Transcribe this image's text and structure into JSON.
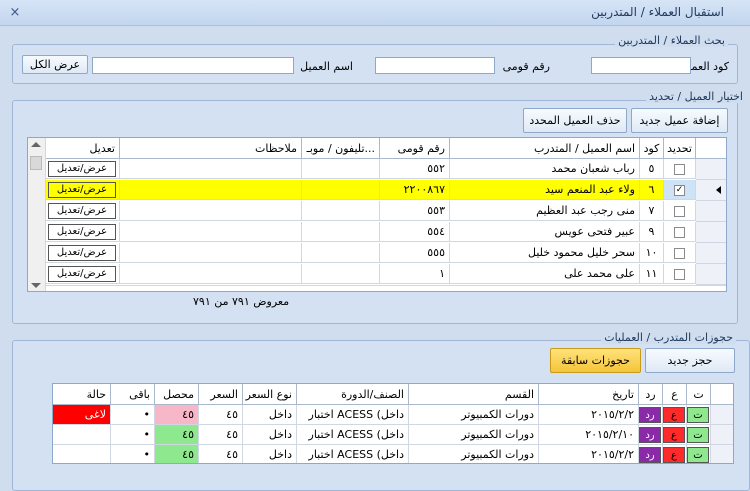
{
  "window": {
    "title": "استقبال العملاء / المتدربين",
    "close_icon": "×"
  },
  "search": {
    "group_label": "بحث العملاء / المتدربين",
    "code_label": "كود العميل",
    "name_label": "اسم العميل",
    "national_id_label": "رقم قومى",
    "show_all_label": "عرض الكل"
  },
  "select": {
    "group_label": "اختيار العميل / تحديد",
    "add_new_label": "إضافة عميل جديد",
    "delete_label": "حذف العميل المحدد",
    "columns": {
      "select": "تحديد",
      "code": "كود",
      "name": "اسم العميل / المتدرب",
      "national_id": "رقم قومى",
      "phone": "تليفون / موبـ...",
      "notes": "ملاحظات",
      "edit": "تعديل"
    },
    "rows": [
      {
        "checked": false,
        "code": "٥",
        "name": "رباب شعبان محمد",
        "national_id": "٥٥٢",
        "edit": "عرض/تعديل"
      },
      {
        "checked": true,
        "code": "٦",
        "name": "ولاء عبد المنعم سيد",
        "national_id": "٢٢٠٠٨٦٧",
        "edit": "عرض/تعديل"
      },
      {
        "checked": false,
        "code": "٧",
        "name": "منى رجب عبد العظيم",
        "national_id": "٥٥٣",
        "edit": "عرض/تعديل"
      },
      {
        "checked": false,
        "code": "٩",
        "name": "عبير فتحى عويس",
        "national_id": "٥٥٤",
        "edit": "عرض/تعديل"
      },
      {
        "checked": false,
        "code": "١٠",
        "name": "سحر خليل محمود خليل",
        "national_id": "٥٥٥",
        "edit": "عرض/تعديل"
      },
      {
        "checked": false,
        "code": "١١",
        "name": "على محمد على",
        "national_id": "١",
        "edit": "عرض/تعديل"
      }
    ],
    "count_text": "معروض ٧٩١ من ٧٩١"
  },
  "bookings": {
    "group_label": "حجوزات المتدرب / العمليات",
    "new_booking_label": "حجز جديد",
    "prev_bookings_label": "حجوزات سابقة",
    "columns": {
      "t": "ت",
      "a": "ع",
      "r": "رد",
      "date": "تاريخ",
      "dept": "القسم",
      "course": "الصنف/الدورة",
      "price_type": "نوع السعر",
      "price": "السعر",
      "paid": "محصل",
      "remaining": "باقى",
      "status": "حالة"
    },
    "rows": [
      {
        "t": "ت",
        "a": "ع",
        "r": "رد",
        "date": "٢٠١٥/٢/٢",
        "dept": "دورات الكمبيوتر",
        "course": "اختبار ACESS (داخل",
        "price_type": "داخل",
        "price": "٤٥",
        "paid": "٤٥",
        "remaining": "•",
        "status": "لاغى"
      },
      {
        "t": "ت",
        "a": "ع",
        "r": "رد",
        "date": "٢٠١٥/٢/١٠",
        "dept": "دورات الكمبيوتر",
        "course": "اختبار ACESS (داخل",
        "price_type": "داخل",
        "price": "٤٥",
        "paid": "٤٥",
        "remaining": "•",
        "status": ""
      },
      {
        "t": "ت",
        "a": "ع",
        "r": "رد",
        "date": "٢٠١٥/٢/٢",
        "dept": "دورات الكمبيوتر",
        "course": "اختبار ACESS (داخل",
        "price_type": "داخل",
        "price": "٤٥",
        "paid": "٤٥",
        "remaining": "•",
        "status": ""
      }
    ]
  },
  "colors": {
    "selected_row": "#ffff00",
    "t_badge": "#8ee88e",
    "a_badge": "#ff2a2a",
    "r_badge": "#8a2aa8",
    "cancel_status": "#ff0000",
    "paid_pink": "#f7b7c8",
    "paid_green": "#8ee88e"
  }
}
